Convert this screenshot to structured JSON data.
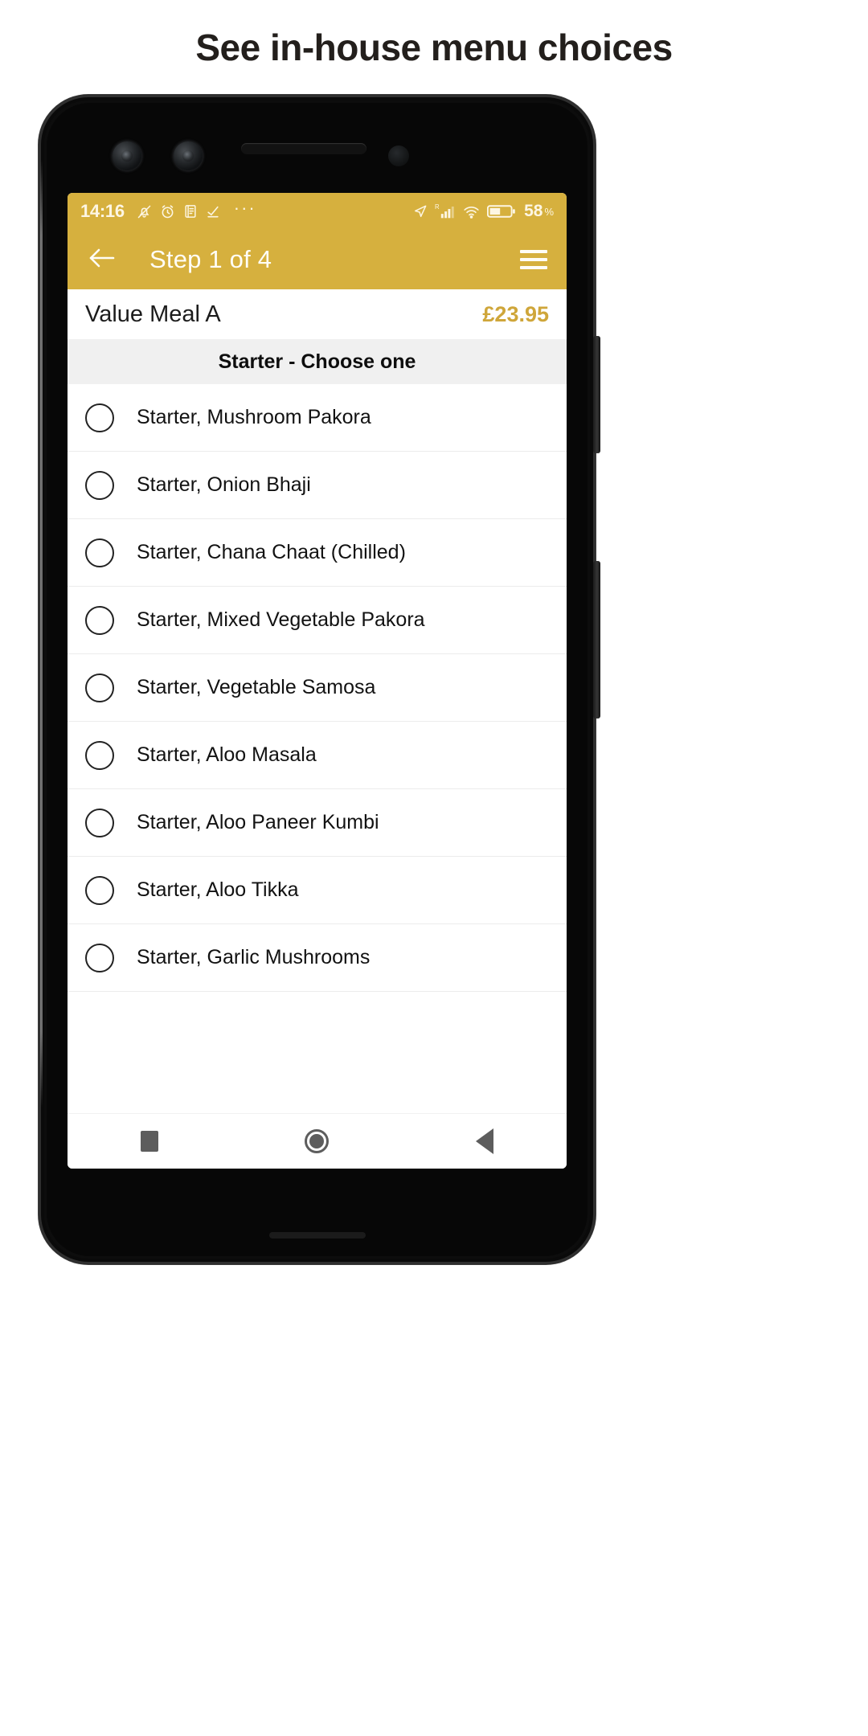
{
  "heading": "See in-house menu choices",
  "phone": {
    "status_bar": {
      "time": "14:16",
      "icons_left": [
        "bell-off-icon",
        "alarm-icon",
        "document-icon",
        "check-download-icon",
        "more-dots-icon"
      ],
      "icons_right": [
        "location-arrow-icon",
        "roaming-signal-icon",
        "wifi-icon",
        "battery-icon"
      ],
      "roaming_label": "R",
      "battery_percent": "58",
      "battery_percent_symbol": "%",
      "background_color": "#d6b03e"
    },
    "app_bar": {
      "back_label": "back-arrow",
      "title": "Step 1 of 4",
      "menu_label": "menu",
      "background_color": "#d6b03e"
    },
    "meal": {
      "name": "Value Meal A",
      "price": "£23.95",
      "price_color": "#cfa63a"
    },
    "section": {
      "header": "Starter - Choose one"
    },
    "options": [
      {
        "label": "Starter, Mushroom Pakora",
        "selected": false
      },
      {
        "label": "Starter, Onion Bhaji",
        "selected": false
      },
      {
        "label": "Starter, Chana Chaat (Chilled)",
        "selected": false
      },
      {
        "label": "Starter, Mixed Vegetable Pakora",
        "selected": false
      },
      {
        "label": "Starter, Vegetable Samosa",
        "selected": false
      },
      {
        "label": "Starter, Aloo Masala",
        "selected": false
      },
      {
        "label": "Starter, Aloo Paneer Kumbi",
        "selected": false
      },
      {
        "label": "Starter, Aloo Tikka",
        "selected": false
      },
      {
        "label": "Starter, Garlic Mushrooms",
        "selected": false
      }
    ],
    "nav_bar": {
      "recents": "recents-square-icon",
      "home": "home-circle-icon",
      "back": "back-triangle-icon"
    }
  }
}
